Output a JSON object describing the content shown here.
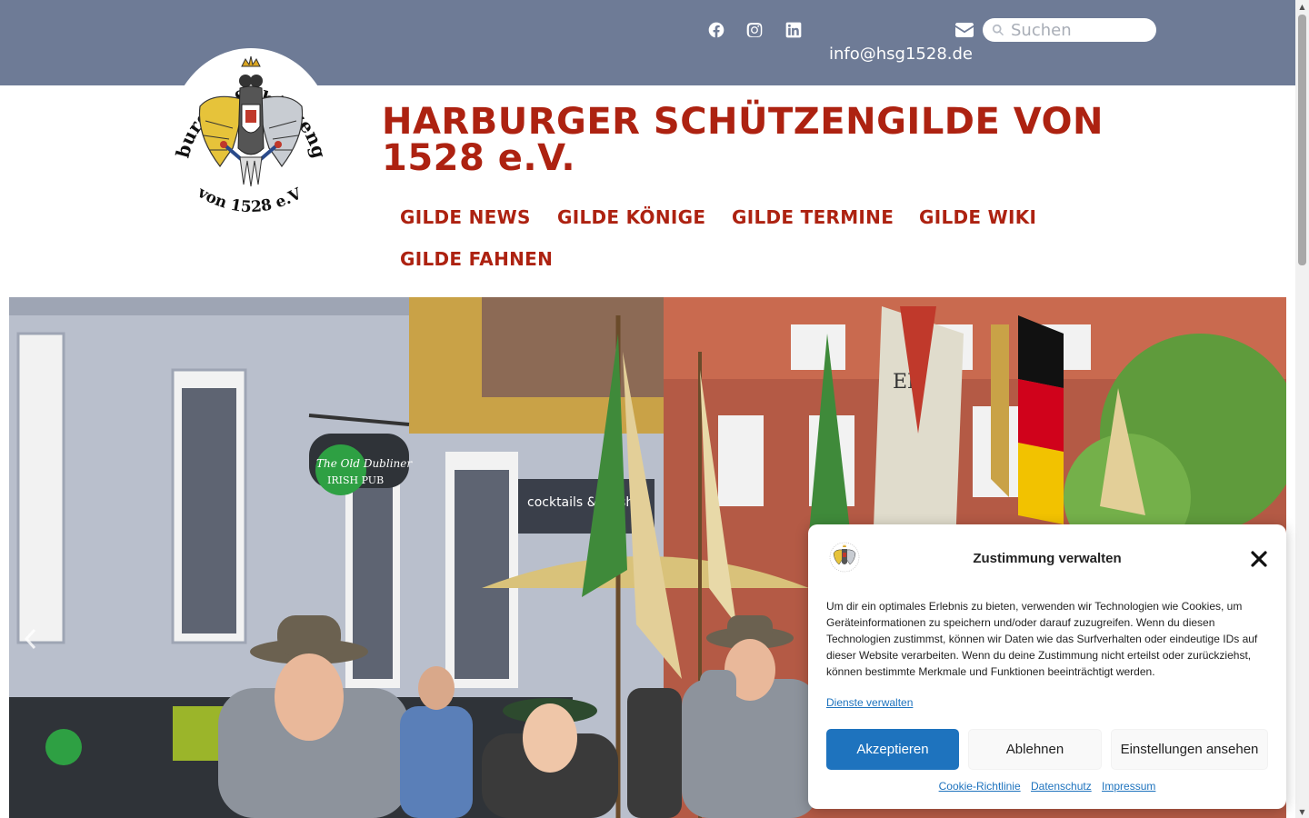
{
  "topbar": {
    "social": [
      {
        "name": "facebook-icon"
      },
      {
        "name": "instagram-icon"
      },
      {
        "name": "linkedin-icon"
      }
    ],
    "email": "info@hsg1528.de",
    "mail_icon": "envelope-icon",
    "search": {
      "placeholder": "Suchen",
      "value": ""
    }
  },
  "site": {
    "title": "HARBURGER SCHÜTZENGILDE VON 1528 e.V.",
    "logo_text_top": "Harburger Schützengilde",
    "logo_text_bottom": "von 1528 e.V."
  },
  "nav": {
    "items": [
      {
        "label": "GILDE NEWS"
      },
      {
        "label": "GILDE KÖNIGE"
      },
      {
        "label": "GILDE TERMINE"
      },
      {
        "label": "GILDE WIKI"
      },
      {
        "label": "GILDE FAHNEN"
      }
    ]
  },
  "hero": {
    "pub_sign": "The Old Dubliner",
    "pub_sign_sub": "IRISH PUB",
    "shop_sign": "cocktails & shisha",
    "flag_text": "EN"
  },
  "cookie": {
    "title": "Zustimmung verwalten",
    "text": "Um dir ein optimales Erlebnis zu bieten, verwenden wir Technologien wie Cookies, um Geräteinformationen zu speichern und/oder darauf zuzugreifen. Wenn du diesen Technologien zustimmst, können wir Daten wie das Surfverhalten oder eindeutige IDs auf dieser Website verarbeiten. Wenn du deine Zustimmung nicht erteilst oder zurückziehst, können bestimmte Merkmale und Funktionen beeinträchtigt werden.",
    "services_link": "Dienste verwalten",
    "accept": "Akzeptieren",
    "deny": "Ablehnen",
    "preferences": "Einstellungen ansehen",
    "links": [
      "Cookie-Richtlinie",
      "Datenschutz",
      "Impressum"
    ]
  },
  "colors": {
    "topbar": "#6e7b96",
    "brand_red": "#ad2211",
    "accept_blue": "#1e73be"
  }
}
